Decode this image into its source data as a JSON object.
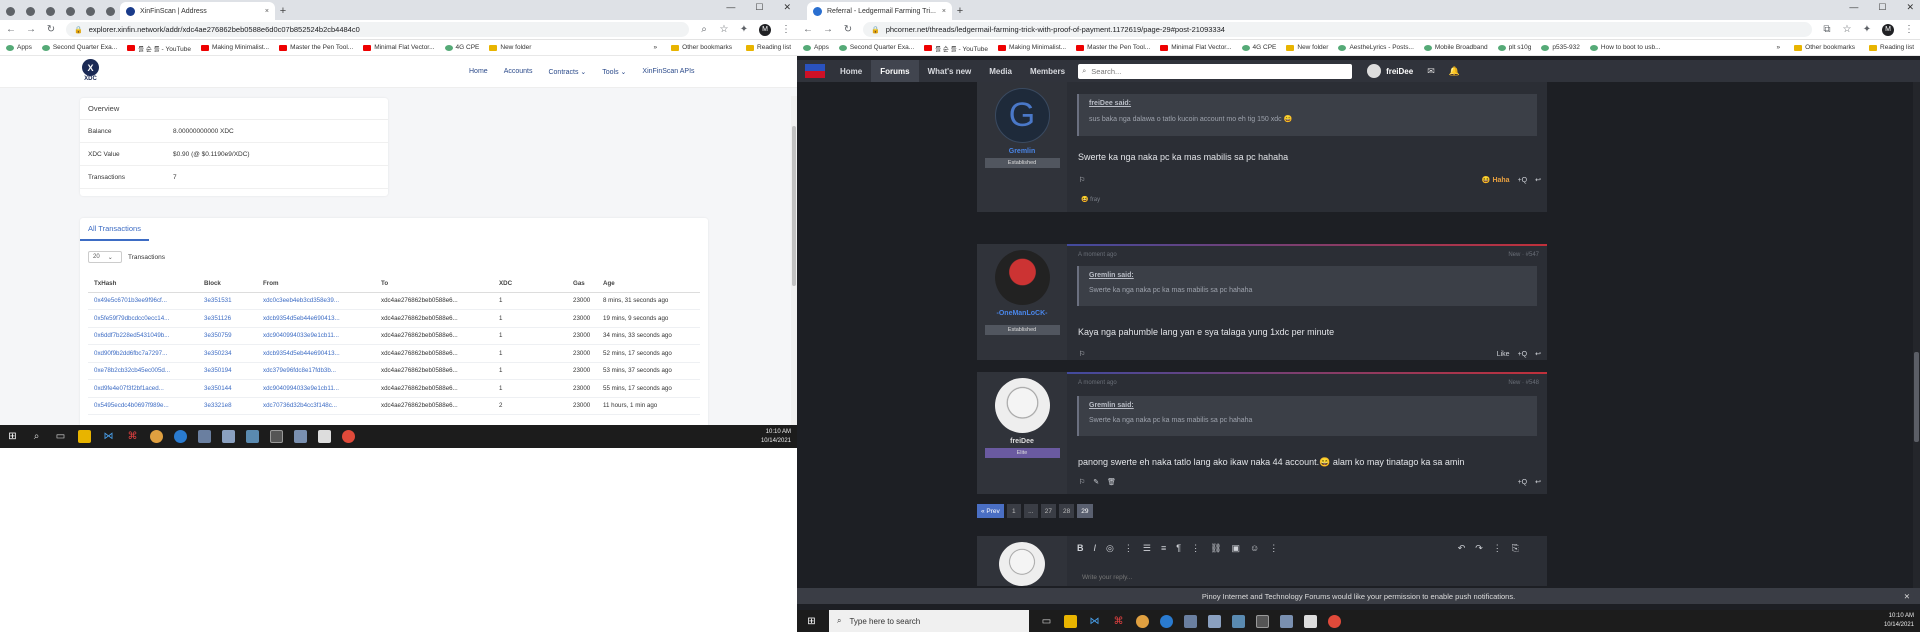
{
  "left": {
    "tab_title": "XinFinScan | Address",
    "tab_close": "×",
    "new_tab": "+",
    "win_controls": [
      "—",
      "☐",
      "✕"
    ],
    "url": "explorer.xinfin.network/addr/xdc4ae276862beb0588e6d0c07b852524b2cb4484c0",
    "bookmarks": [
      "Apps",
      "Second Quarter Exa...",
      "를 순 를 - YouTube",
      "Making Minimalist...",
      "Master the Pen Tool...",
      "Minimal Flat Vector...",
      "4G CPE",
      "New folder"
    ],
    "bookmarks_right": [
      "»",
      "Other bookmarks",
      "Reading list"
    ],
    "logo_text": "XDC",
    "logo_mark": "X",
    "nav": [
      "Home",
      "Accounts",
      "Contracts ⌄",
      "Tools ⌄",
      "XinFinScan APIs"
    ],
    "overview": {
      "title": "Overview",
      "rows": [
        {
          "k": "Balance",
          "v": "8.00000000000 XDC"
        },
        {
          "k": "XDC Value",
          "v": "$0.90 (@ $0.1190e9/XDC)"
        },
        {
          "k": "Transactions",
          "v": "7"
        }
      ]
    },
    "all_tx": {
      "title": "All Transactions",
      "page_size": "20",
      "page_size_label": "Transactions",
      "headers": [
        "TxHash",
        "Block",
        "From",
        "To",
        "XDC",
        "Gas",
        "Age"
      ],
      "rows": [
        [
          "0x49e5c6701b3ee9f96cf...",
          "3e351531",
          "xdc0c3eeb4eb3cd358e39...",
          "xdc4ae276862beb0588e6...",
          "1",
          "23000",
          "8 mins, 31 seconds ago"
        ],
        [
          "0x5fe59f79dbcdcc0ecc14...",
          "3e351126",
          "xdcb9354d5eb44e690413...",
          "xdc4ae276862beb0588e6...",
          "1",
          "23000",
          "19 mins, 9 seconds ago"
        ],
        [
          "0x6ddf7b228ed5431049b...",
          "3e350759",
          "xdc9040994033e9e1cb11...",
          "xdc4ae276862beb0588e6...",
          "1",
          "23000",
          "34 mins, 33 seconds ago"
        ],
        [
          "0xd90f9b2dd6fbc7a7297...",
          "3e350234",
          "xdcb9354d5eb44e690413...",
          "xdc4ae276862beb0588e6...",
          "1",
          "23000",
          "52 mins, 17 seconds ago"
        ],
        [
          "0xe78b2cb32cb45ec005d...",
          "3e350194",
          "xdc379e96fdc8e17fdb3b...",
          "xdc4ae276862beb0588e6...",
          "1",
          "23000",
          "53 mins, 37 seconds ago"
        ],
        [
          "0xd9fe4e07f3f2bf1aced...",
          "3e350144",
          "xdc9040994033e9e1cb11...",
          "xdc4ae276862beb0588e6...",
          "1",
          "23000",
          "55 mins, 17 seconds ago"
        ],
        [
          "0x5495ecdc4b0697f989e...",
          "3e3321e8",
          "xdc70736d32b4cc3f148c...",
          "xdc4ae276862beb0588e6...",
          "2",
          "23000",
          "11 hours, 1 min ago"
        ]
      ]
    },
    "taskbar_time": "10:10 AM",
    "taskbar_date": "10/14/2021"
  },
  "right": {
    "tab_title": "Referral - Ledgermail Farming Tri...",
    "tab_close": "×",
    "new_tab": "+",
    "win_controls": [
      "—",
      "☐",
      "✕"
    ],
    "url": "phcorner.net/threads/ledgermail-farming-trick-with-proof-of-payment.1172619/page-29#post-21093334",
    "bookmarks": [
      "Apps",
      "Second Quarter Exa...",
      "를 순 를 - YouTube",
      "Making Minimalist...",
      "Master the Pen Tool...",
      "Minimal Flat Vector...",
      "4G CPE",
      "New folder",
      "AestheLyrics - Posts...",
      "Mobile Broadband",
      "plt s10g",
      "p535-932",
      "How to boot to usb..."
    ],
    "bookmarks_right": [
      "»",
      "Other bookmarks",
      "Reading list"
    ],
    "nav": [
      "Home",
      "Forums",
      "What's new",
      "Media",
      "Members"
    ],
    "search_placeholder": "Search...",
    "username": "freiDee",
    "posts": [
      {
        "author": "Gremlin",
        "badge": "Established",
        "avatar_letter": "G",
        "quote_author": "freiDee said:",
        "quote_text": "sus baka nga dalawa o tatlo kucoin account mo eh tig 150 xdc 😄",
        "text": "Swerte ka nga naka pc ka mas mabilis sa pc hahaha",
        "reaction": "Haha",
        "reaction_summary": "fray",
        "actions": [
          "+Q",
          "↩"
        ]
      },
      {
        "author": "-OneManLoCK-",
        "badge": "Established",
        "meta": "A moment ago",
        "meta_right": "New  ·  #547",
        "quote_author": "Gremlin said:",
        "quote_text": "Swerte ka nga naka pc ka mas mabilis sa pc hahaha",
        "text": "Kaya nga pahumble lang yan e sya talaga yung 1xdc per minute",
        "actions": [
          "Like",
          "+Q",
          "↩"
        ]
      },
      {
        "author": "freiDee",
        "badge": "Elite",
        "meta": "A moment ago",
        "meta_right": "New  ·  #548",
        "quote_author": "Gremlin said:",
        "quote_text": "Swerte ka nga naka pc ka mas mabilis sa pc hahaha",
        "text": "panong swerte eh naka tatlo lang ako ikaw naka 44 account.😄 alam ko may tinatago ka sa amin",
        "actions": [
          "+Q",
          "↩"
        ]
      }
    ],
    "pager": [
      "« Prev",
      "1",
      "...",
      "27",
      "28",
      "29"
    ],
    "editor_placeholder": "Write your reply...",
    "notification": "Pinoy Internet and Technology Forums would like your permission to enable push notifications.",
    "taskbar_search": "Type here to search",
    "taskbar_time": "10:10 AM",
    "taskbar_date": "10/14/2021"
  }
}
